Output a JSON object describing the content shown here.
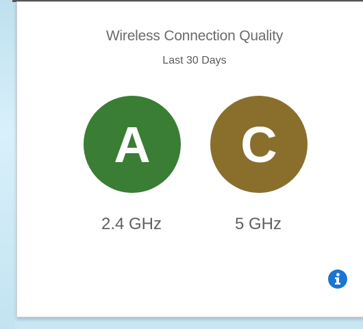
{
  "widget": {
    "title": "Wireless Connection Quality",
    "subtitle": "Last 30 Days"
  },
  "bands": [
    {
      "label": "2.4 GHz",
      "grade": "A",
      "color": "#3a7d34"
    },
    {
      "label": "5 GHz",
      "grade": "C",
      "color": "#8a6f2c"
    }
  ],
  "info": {
    "icon": "info-icon",
    "color": "#1a76d2"
  }
}
